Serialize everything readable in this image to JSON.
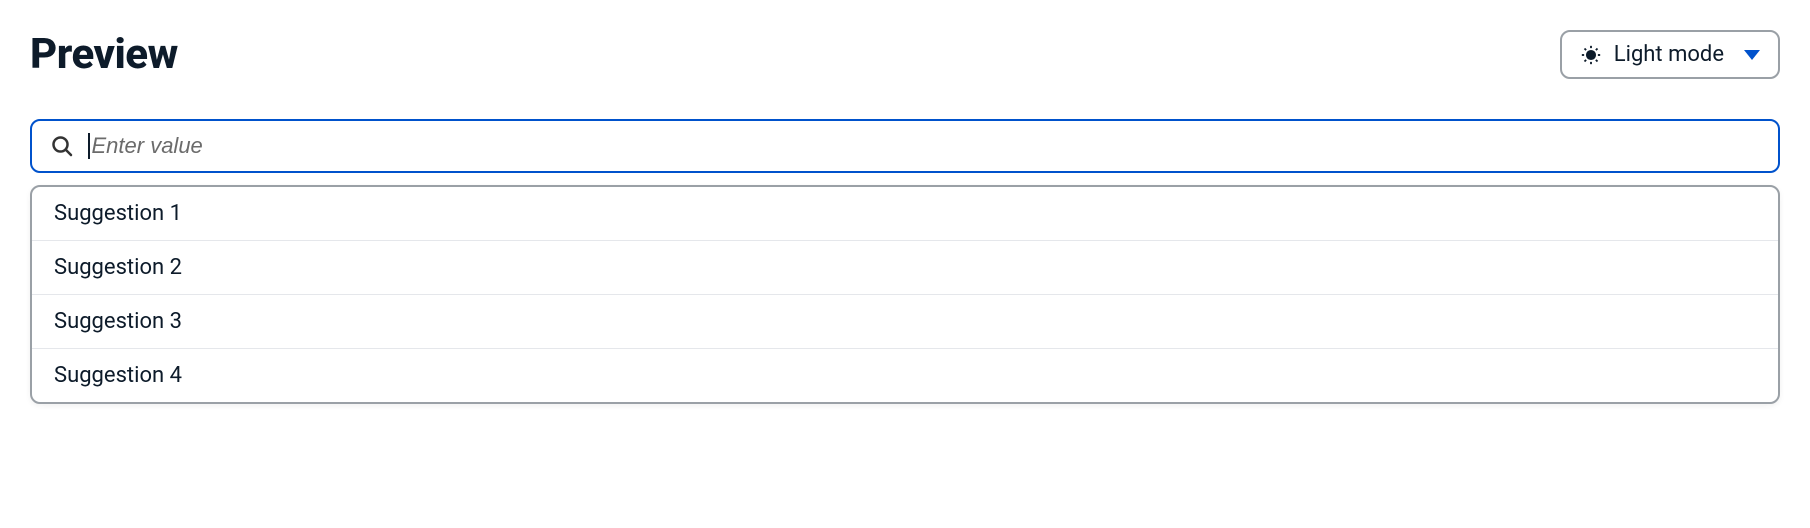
{
  "header": {
    "title": "Preview",
    "theme_selector": {
      "selected_label": "Light mode"
    }
  },
  "search": {
    "placeholder": "Enter value",
    "value": ""
  },
  "suggestions": {
    "items": [
      {
        "label": "Suggestion 1"
      },
      {
        "label": "Suggestion 2"
      },
      {
        "label": "Suggestion 3"
      },
      {
        "label": "Suggestion 4"
      }
    ]
  }
}
